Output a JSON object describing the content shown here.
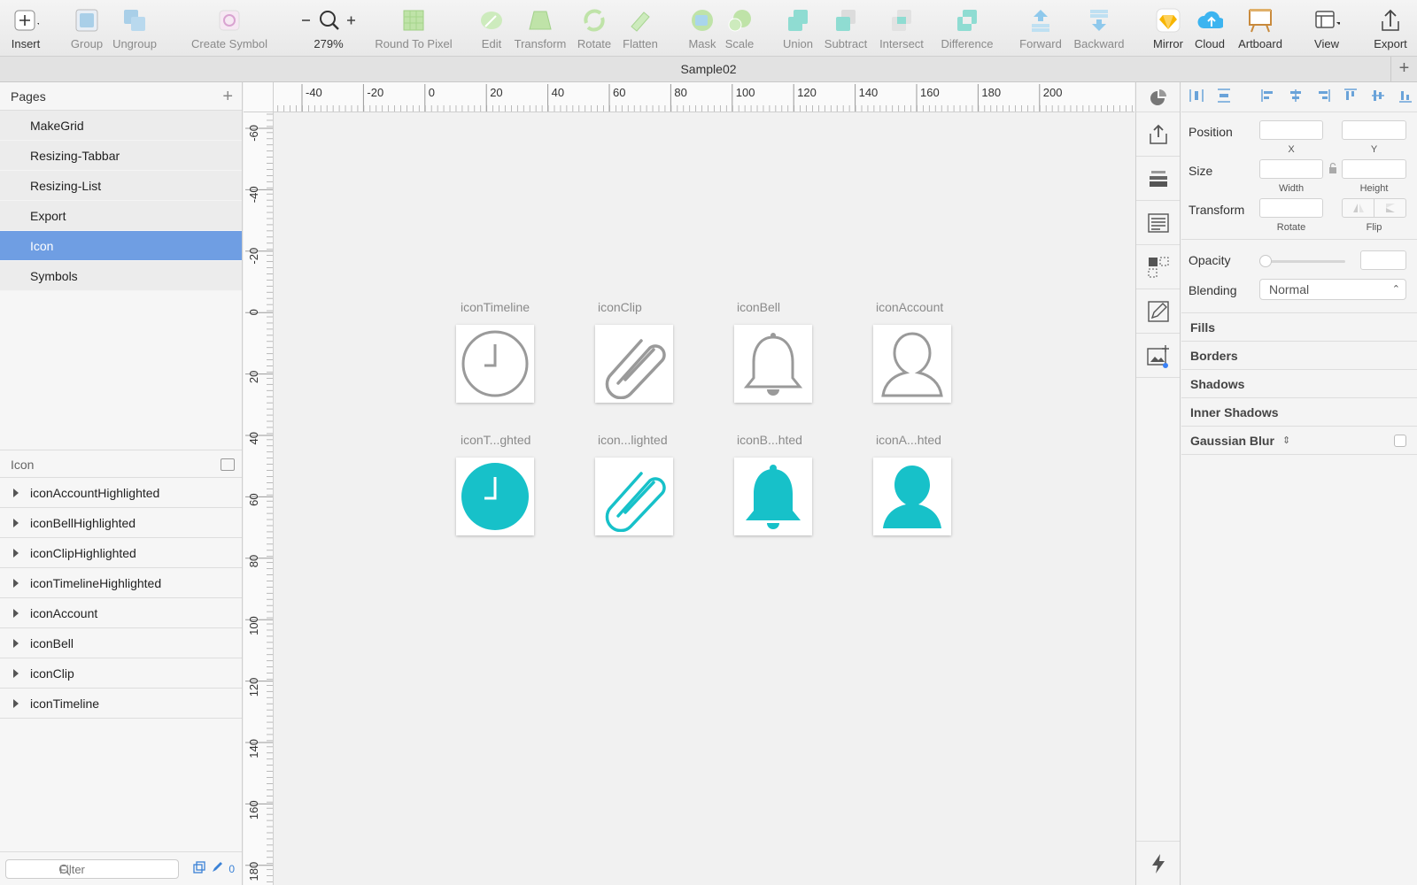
{
  "toolbar": {
    "items": [
      {
        "label": "Insert"
      },
      {
        "label": "Group"
      },
      {
        "label": "Ungroup"
      },
      {
        "label": "Create Symbol"
      },
      {
        "label": "279%"
      },
      {
        "label": "Round To Pixel"
      },
      {
        "label": "Edit"
      },
      {
        "label": "Transform"
      },
      {
        "label": "Rotate"
      },
      {
        "label": "Flatten"
      },
      {
        "label": "Mask"
      },
      {
        "label": "Scale"
      },
      {
        "label": "Union"
      },
      {
        "label": "Subtract"
      },
      {
        "label": "Intersect"
      },
      {
        "label": "Difference"
      },
      {
        "label": "Forward"
      },
      {
        "label": "Backward"
      },
      {
        "label": "Mirror"
      },
      {
        "label": "Cloud"
      },
      {
        "label": "Artboard"
      },
      {
        "label": "View"
      },
      {
        "label": "Export"
      }
    ]
  },
  "document": {
    "title": "Sample02"
  },
  "pages": {
    "header": "Pages",
    "items": [
      {
        "label": "MakeGrid"
      },
      {
        "label": "Resizing-Tabbar"
      },
      {
        "label": "Resizing-List"
      },
      {
        "label": "Export"
      },
      {
        "label": "Icon",
        "selected": true
      },
      {
        "label": "Symbols"
      }
    ]
  },
  "layers": {
    "header": "Icon",
    "items": [
      {
        "label": "iconAccountHighlighted"
      },
      {
        "label": "iconBellHighlighted"
      },
      {
        "label": "iconClipHighlighted"
      },
      {
        "label": "iconTimelineHighlighted"
      },
      {
        "label": "iconAccount"
      },
      {
        "label": "iconBell"
      },
      {
        "label": "iconClip"
      },
      {
        "label": "iconTimeline"
      }
    ],
    "filter_placeholder": "Filter",
    "filter_count": "0"
  },
  "rulers": {
    "top": [
      "-40",
      "-20",
      "0",
      "20",
      "40",
      "60",
      "80",
      "100",
      "120",
      "140",
      "160",
      "180",
      "200"
    ],
    "left": [
      "-60",
      "-40",
      "-20",
      "0",
      "20",
      "40",
      "60",
      "80",
      "100",
      "120",
      "140",
      "160",
      "180"
    ]
  },
  "canvas": {
    "artboards": [
      {
        "label": "iconTimeline",
        "icon": "clock-icon",
        "highlighted": false
      },
      {
        "label": "iconClip",
        "icon": "paperclip-icon",
        "highlighted": false
      },
      {
        "label": "iconBell",
        "icon": "bell-icon",
        "highlighted": false
      },
      {
        "label": "iconAccount",
        "icon": "person-icon",
        "highlighted": false
      },
      {
        "label": "iconT...ghted",
        "icon": "clock-icon",
        "highlighted": true
      },
      {
        "label": "icon...lighted",
        "icon": "paperclip-icon",
        "highlighted": true
      },
      {
        "label": "iconB...hted",
        "icon": "bell-icon",
        "highlighted": true
      },
      {
        "label": "iconA...hted",
        "icon": "person-icon",
        "highlighted": true
      }
    ],
    "colors": {
      "outline": "#9a9a9a",
      "highlight": "#17c1c9"
    }
  },
  "inspector": {
    "position_label": "Position",
    "x_label": "X",
    "y_label": "Y",
    "size_label": "Size",
    "width_label": "Width",
    "height_label": "Height",
    "transform_label": "Transform",
    "rotate_label": "Rotate",
    "flip_label": "Flip",
    "opacity_label": "Opacity",
    "blending_label": "Blending",
    "blending_value": "Normal",
    "sections": [
      {
        "label": "Fills"
      },
      {
        "label": "Borders"
      },
      {
        "label": "Shadows"
      },
      {
        "label": "Inner Shadows"
      },
      {
        "label": "Gaussian Blur"
      }
    ]
  }
}
